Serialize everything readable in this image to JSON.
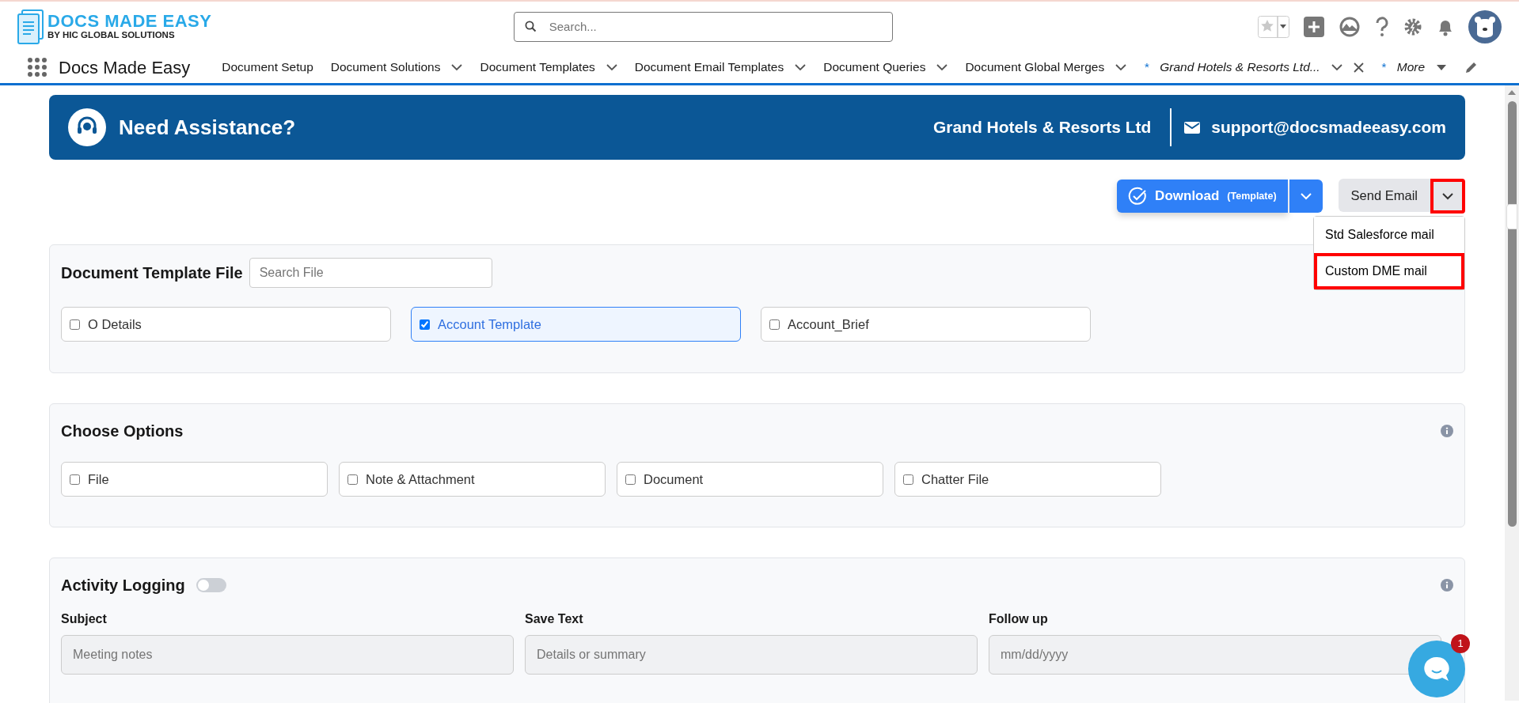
{
  "logo": {
    "title": "DOCS MADE EASY",
    "subtitle": "BY HIC GLOBAL SOLUTIONS"
  },
  "search": {
    "placeholder": "Search..."
  },
  "app_name": "Docs Made Easy",
  "nav_tabs": [
    {
      "kind": "tab",
      "label": "Document Setup",
      "has_menu": false
    },
    {
      "kind": "tab",
      "label": "Document Solutions",
      "has_menu": true
    },
    {
      "kind": "tab",
      "label": "Document Templates",
      "has_menu": true
    },
    {
      "kind": "tab",
      "label": "Document Email Templates",
      "has_menu": true
    },
    {
      "kind": "tab",
      "label": "Document Queries",
      "has_menu": true
    },
    {
      "kind": "tab",
      "label": "Document Global Merges",
      "has_menu": true
    },
    {
      "kind": "record",
      "marker": "*",
      "label": "Grand Hotels & Resorts Ltd...",
      "has_menu": true
    },
    {
      "kind": "more",
      "marker": "*",
      "label": "More",
      "has_menu": true
    }
  ],
  "banner": {
    "title": "Need Assistance?",
    "company": "Grand Hotels & Resorts Ltd",
    "email": "support@docsmadeeasy.com"
  },
  "actions": {
    "download": {
      "label": "Download",
      "note": "(Template)"
    },
    "send_email": {
      "label": "Send Email",
      "highlighted": true
    },
    "menu": [
      {
        "label": "Std Salesforce mail",
        "highlighted": false
      },
      {
        "label": "Custom DME mail",
        "highlighted": true
      }
    ]
  },
  "template_card": {
    "title": "Document Template File",
    "search_placeholder": "Search File",
    "files": [
      {
        "label": "O Details",
        "checked": false
      },
      {
        "label": "Account Template",
        "checked": true
      },
      {
        "label": "Account_Brief",
        "checked": false
      }
    ]
  },
  "options_card": {
    "title": "Choose Options",
    "options": [
      {
        "label": "File",
        "checked": false
      },
      {
        "label": "Note & Attachment",
        "checked": false
      },
      {
        "label": "Document",
        "checked": false
      },
      {
        "label": "Chatter File",
        "checked": false
      }
    ]
  },
  "activity_card": {
    "title": "Activity Logging",
    "enabled": false,
    "fields": [
      {
        "label": "Subject",
        "placeholder": "Meeting notes"
      },
      {
        "label": "Save Text",
        "placeholder": "Details or summary"
      },
      {
        "label": "Follow up",
        "placeholder": "mm/dd/yyyy"
      }
    ]
  },
  "chat": {
    "badge": "1"
  }
}
